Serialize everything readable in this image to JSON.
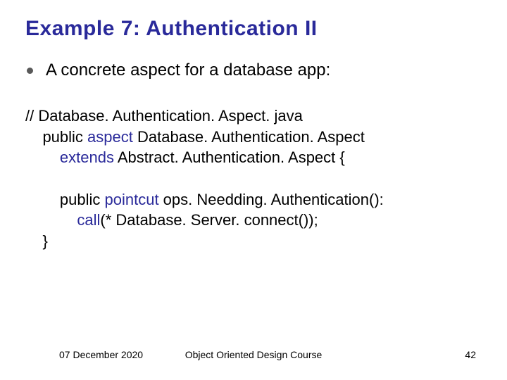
{
  "title": "Example 7: Authentication II",
  "bullet": "A concrete aspect for a database app:",
  "code": {
    "l1": "// Database. Authentication. Aspect. java",
    "l2_pre": "    public ",
    "l2_kw": "aspect",
    "l2_post": " Database. Authentication. Aspect",
    "l3_pre": "        ",
    "l3_kw": "extends",
    "l3_post": " Abstract. Authentication. Aspect {",
    "l4": " ",
    "l5_pre": "        public ",
    "l5_kw": "pointcut",
    "l5_post": " ops. Needding. Authentication():",
    "l6_pre": "            ",
    "l6_kw": "call",
    "l6_post": "(* Database. Server. connect());",
    "l7": "    }"
  },
  "footer": {
    "date": "07 December 2020",
    "course": "Object Oriented Design Course",
    "page": "42"
  }
}
